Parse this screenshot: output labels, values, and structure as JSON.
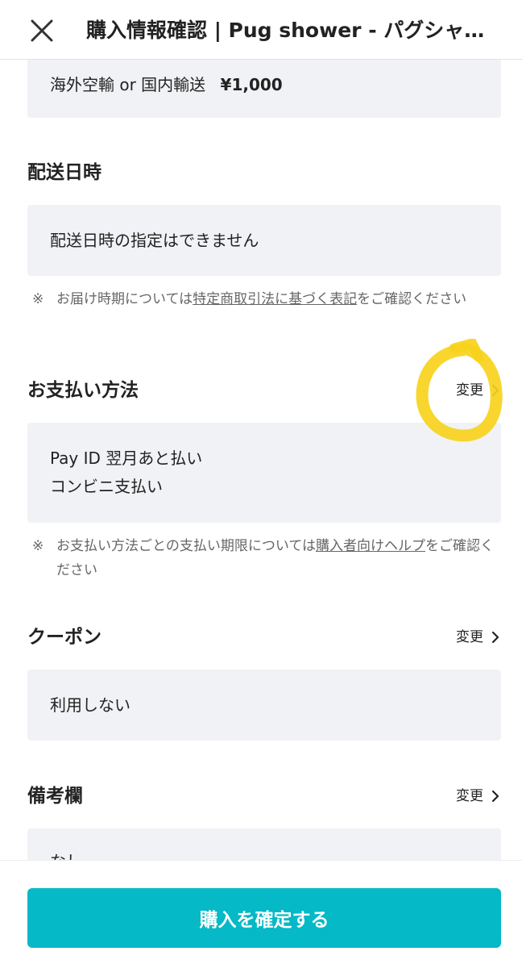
{
  "header": {
    "title": "購入情報確認 | Pug shower - パグシャ…",
    "close_icon": "close-icon"
  },
  "shipping_method": {
    "text": "海外空輸 or 国内輸送",
    "price": "¥1,000"
  },
  "delivery_date": {
    "title": "配送日時",
    "value": "配送日時の指定はできません",
    "note_mark": "※",
    "note_before": "お届け時期については",
    "note_link": "特定商取引法に基づく表記",
    "note_after": "をご確認ください"
  },
  "payment": {
    "title": "お支払い方法",
    "change_label": "変更",
    "line1": "Pay ID 翌月あと払い",
    "line2": "コンビニ支払い",
    "note_mark": "※",
    "note_before": "お支払い方法ごとの支払い期限については",
    "note_link": "購入者向けヘルプ",
    "note_after": "をご確認ください"
  },
  "coupon": {
    "title": "クーポン",
    "change_label": "変更",
    "value": "利用しない"
  },
  "remarks": {
    "title": "備考欄",
    "change_label": "変更",
    "value": "なし"
  },
  "footer": {
    "confirm_label": "購入を確定する"
  },
  "colors": {
    "accent": "#05b9c6",
    "box_background": "#f1f2f5",
    "highlight_marker": "#f7d31c"
  }
}
